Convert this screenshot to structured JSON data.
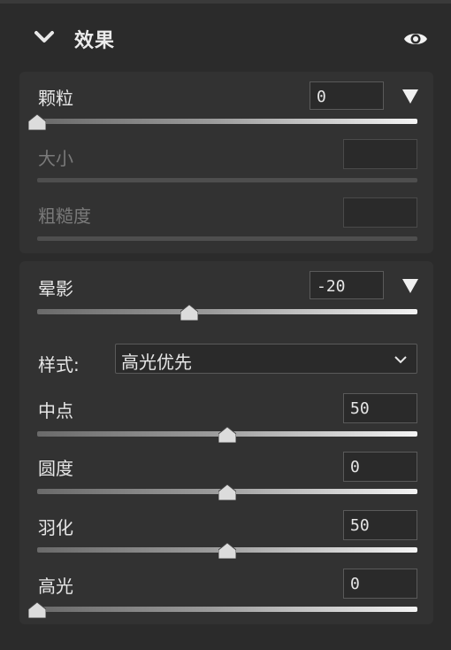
{
  "header": {
    "title": "效果",
    "chevron_icon": "chevron-down-icon",
    "visibility_icon": "eye-icon"
  },
  "grain": {
    "label": "颗粒",
    "value": "0",
    "slider_fraction": 0.0,
    "size_label": "大小",
    "size_value": "",
    "roughness_label": "粗糙度",
    "roughness_value": ""
  },
  "vignette": {
    "label": "晕影",
    "value": "-20",
    "slider_fraction": 0.4,
    "style_label": "样式:",
    "style_value": "高光优先",
    "midpoint_label": "中点",
    "midpoint_value": "50",
    "midpoint_fraction": 0.5,
    "roundness_label": "圆度",
    "roundness_value": "0",
    "roundness_fraction": 0.5,
    "feather_label": "羽化",
    "feather_value": "50",
    "feather_fraction": 0.5,
    "highlights_label": "高光",
    "highlights_value": "0",
    "highlights_fraction": 0.0
  }
}
